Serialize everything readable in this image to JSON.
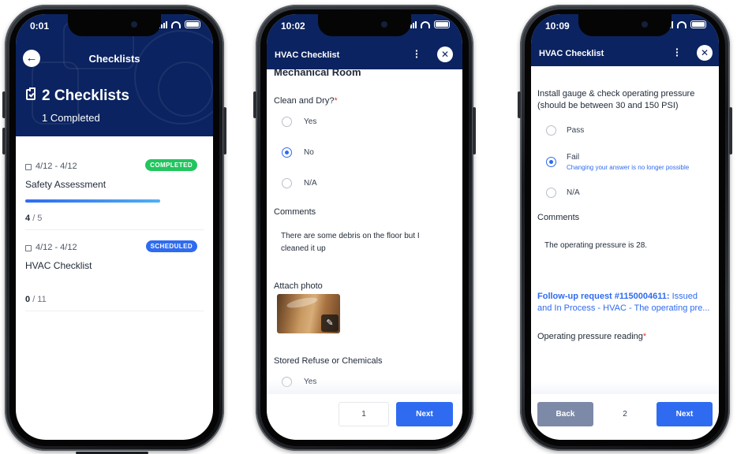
{
  "screen1": {
    "status_time": "0:01",
    "header_title": "Checklists",
    "count_title": "2 Checklists",
    "completed_text": "1 Completed",
    "cards": [
      {
        "dates": "4/12 - 4/12",
        "badge": "COMPLETED",
        "badge_color": "#22c55e",
        "title": "Safety Assessment",
        "done": "4",
        "total": "/ 5",
        "progress": 0.8
      },
      {
        "dates": "4/12 - 4/12",
        "badge": "SCHEDULED",
        "badge_color": "#2f6bf0",
        "title": "HVAC Checklist",
        "done": "0",
        "total": "/ 11",
        "progress": 0
      }
    ],
    "icons": [
      "back-arrow-icon",
      "clipboard-check-icon",
      "calendar-icon"
    ]
  },
  "screen2": {
    "status_time": "10:02",
    "header_title": "HVAC Checklist",
    "section_heading": "Mechanical Room",
    "question1": "Clean and Dry?",
    "required_mark": "*",
    "options": [
      "Yes",
      "No",
      "N/A"
    ],
    "selected_option": "No",
    "comments_label": "Comments",
    "comments_value": "There are some debris on the floor but I cleaned it up",
    "attach_label": "Attach photo",
    "question2": "Stored Refuse or Chemicals",
    "question2_option": "Yes",
    "page_number": "1",
    "next_label": "Next",
    "icons": [
      "more-vertical-icon",
      "close-icon",
      "pencil-icon"
    ]
  },
  "screen3": {
    "status_time": "10:09",
    "header_title": "HVAC Checklist",
    "question": "Install gauge & check operating pressure (should be between 30 and 150 PSI)",
    "options": [
      "Pass",
      "Fail",
      "N/A"
    ],
    "selected_option": "Fail",
    "fail_note": "Changing your answer is no longer possible",
    "comments_label": "Comments",
    "comments_value": "The operating pressure is 28.",
    "followup_link": "Follow-up request #1150004611:",
    "followup_rest": " Issued and In Process - HVAC - The operating pre...",
    "reading_label": "Operating pressure reading",
    "required_mark": "*",
    "back_label": "Back",
    "page_number": "2",
    "next_label": "Next",
    "icons": [
      "more-vertical-icon",
      "close-icon"
    ]
  },
  "colors": {
    "navy": "#0b2360",
    "accent": "#2f6bf0",
    "completed": "#22c55e",
    "required": "#e03a3a"
  }
}
